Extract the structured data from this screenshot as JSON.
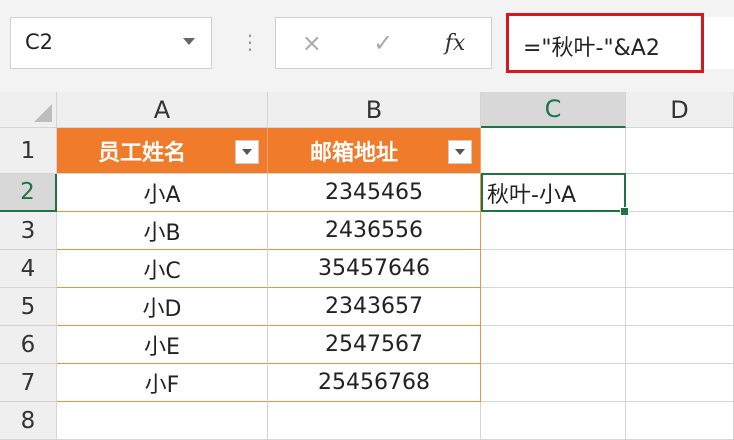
{
  "name_box": "C2",
  "formula_bar": {
    "cancel_icon": "×",
    "enter_icon": "✓",
    "fx_label": "fx",
    "formula": "=\"秋叶-\"&A2"
  },
  "columns": [
    "A",
    "B",
    "C",
    "D"
  ],
  "rows": [
    "1",
    "2",
    "3",
    "4",
    "5",
    "6",
    "7",
    "8"
  ],
  "table": {
    "headers": [
      "员工姓名",
      "邮箱地址"
    ],
    "rows": [
      [
        "小A",
        "2345465"
      ],
      [
        "小B",
        "2436556"
      ],
      [
        "小C",
        "35457646"
      ],
      [
        "小D",
        "2343657"
      ],
      [
        "小E",
        "2547567"
      ],
      [
        "小F",
        "25456768"
      ]
    ]
  },
  "c2_value": "秋叶-小A",
  "colors": {
    "header_orange": "#f07b2b",
    "selection_green": "#217346",
    "highlight_red": "#d9161e"
  }
}
